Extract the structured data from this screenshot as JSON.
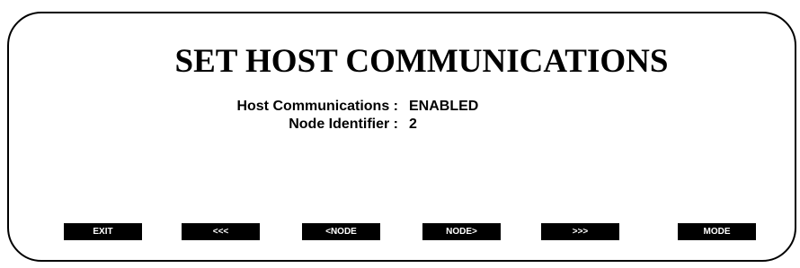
{
  "screen": {
    "title": "SET HOST COMMUNICATIONS"
  },
  "fields": {
    "host_communications": {
      "label": "Host Communications :",
      "value": "ENABLED"
    },
    "node_identifier": {
      "label": "Node Identifier :",
      "value": "2"
    }
  },
  "softkeys": {
    "exit": "EXIT",
    "prev": "<<<",
    "prev_node": "<NODE",
    "next_node": "NODE>",
    "next": ">>>",
    "mode": "MODE"
  }
}
